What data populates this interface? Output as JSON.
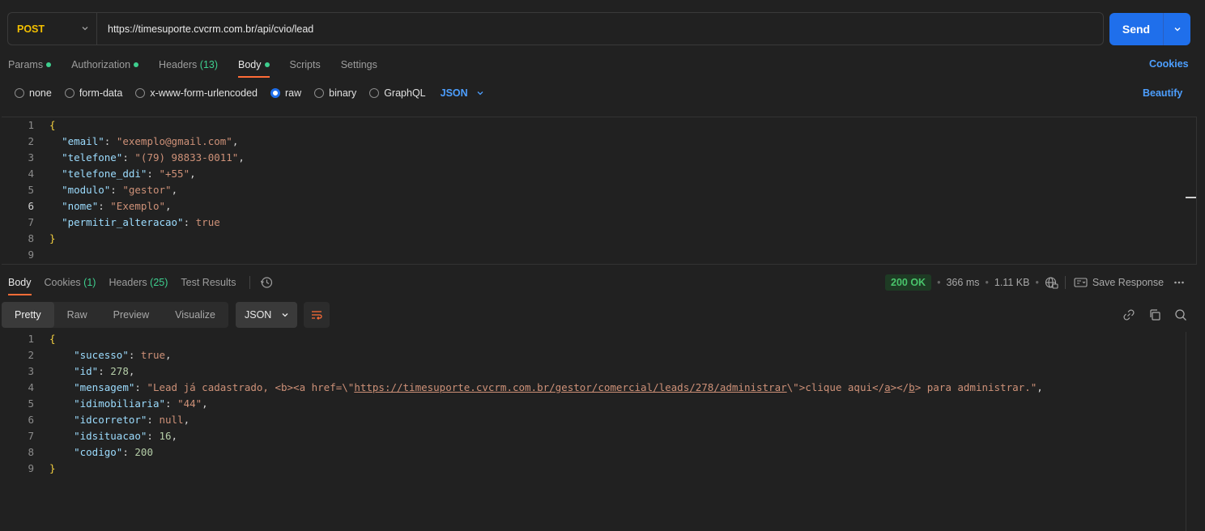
{
  "request": {
    "method": "POST",
    "url": "https://timesuporte.cvcrm.com.br/api/cvio/lead",
    "send_label": "Send"
  },
  "request_tabs": [
    {
      "label": "Params",
      "dot": true
    },
    {
      "label": "Authorization",
      "dot": true
    },
    {
      "label": "Headers",
      "count": "(13)"
    },
    {
      "label": "Body",
      "dot": true,
      "active": true
    },
    {
      "label": "Scripts"
    },
    {
      "label": "Settings"
    }
  ],
  "cookies_link": "Cookies",
  "beautify_link": "Beautify",
  "body_types": [
    "none",
    "form-data",
    "x-www-form-urlencoded",
    "raw",
    "binary",
    "GraphQL"
  ],
  "body_type_selected": "raw",
  "body_language": "JSON",
  "request_body": {
    "line_numbers": [
      "1",
      "2",
      "3",
      "4",
      "5",
      "6",
      "7",
      "8",
      "9"
    ],
    "open": "{",
    "close": "}",
    "fields": [
      {
        "key": "\"email\"",
        "value": "\"exemplo@gmail.com\"",
        "comma": ","
      },
      {
        "key": "\"telefone\"",
        "value": "\"(79) 98833-0011\"",
        "comma": ","
      },
      {
        "key": "\"telefone_ddi\"",
        "value": "\"+55\"",
        "comma": ","
      },
      {
        "key": "\"modulo\"",
        "value": "\"gestor\"",
        "comma": ","
      },
      {
        "key": "\"nome\"",
        "value": "\"Exemplo\"",
        "comma": ","
      },
      {
        "key": "\"permitir_alteracao\"",
        "value": "true",
        "comma": ""
      }
    ]
  },
  "response_tabs": [
    {
      "label": "Body",
      "active": true
    },
    {
      "label": "Cookies",
      "count": "(1)"
    },
    {
      "label": "Headers",
      "count": "(25)"
    },
    {
      "label": "Test Results"
    }
  ],
  "response_meta": {
    "status": "200 OK",
    "time": "366 ms",
    "size": "1.11 KB",
    "save_response": "Save Response"
  },
  "view_tabs": [
    "Pretty",
    "Raw",
    "Preview",
    "Visualize"
  ],
  "view_selected": "Pretty",
  "response_format": "JSON",
  "response_body": {
    "line_numbers": [
      "1",
      "2",
      "3",
      "4",
      "5",
      "6",
      "7",
      "8",
      "9"
    ],
    "open": "{",
    "close": "}",
    "sucesso_key": "\"sucesso\"",
    "sucesso_val": "true",
    "id_key": "\"id\"",
    "id_val": "278",
    "mensagem_key": "\"mensagem\"",
    "mensagem_p1": "\"Lead já cadastrado, <b><a href=\\\"",
    "mensagem_link": "https://timesuporte.cvcrm.com.br/gestor/comercial/leads/278/administrar",
    "mensagem_p2": "\\\">clique aqui</",
    "mensagem_a": "a",
    "mensagem_p3": "></",
    "mensagem_b": "b",
    "mensagem_p4": "> para administrar.\"",
    "idimobiliaria_key": "\"idimobiliaria\"",
    "idimobiliaria_val": "\"44\"",
    "idcorretor_key": "\"idcorretor\"",
    "idcorretor_val": "null",
    "idsituacao_key": "\"idsituacao\"",
    "idsituacao_val": "16",
    "codigo_key": "\"codigo\"",
    "codigo_val": "200"
  },
  "colors": {
    "method": "#f4c000",
    "send": "#1f6feb",
    "active_tab_underline": "#ff6c37",
    "status_ok": "#49c46b",
    "link": "#4d9fff"
  }
}
